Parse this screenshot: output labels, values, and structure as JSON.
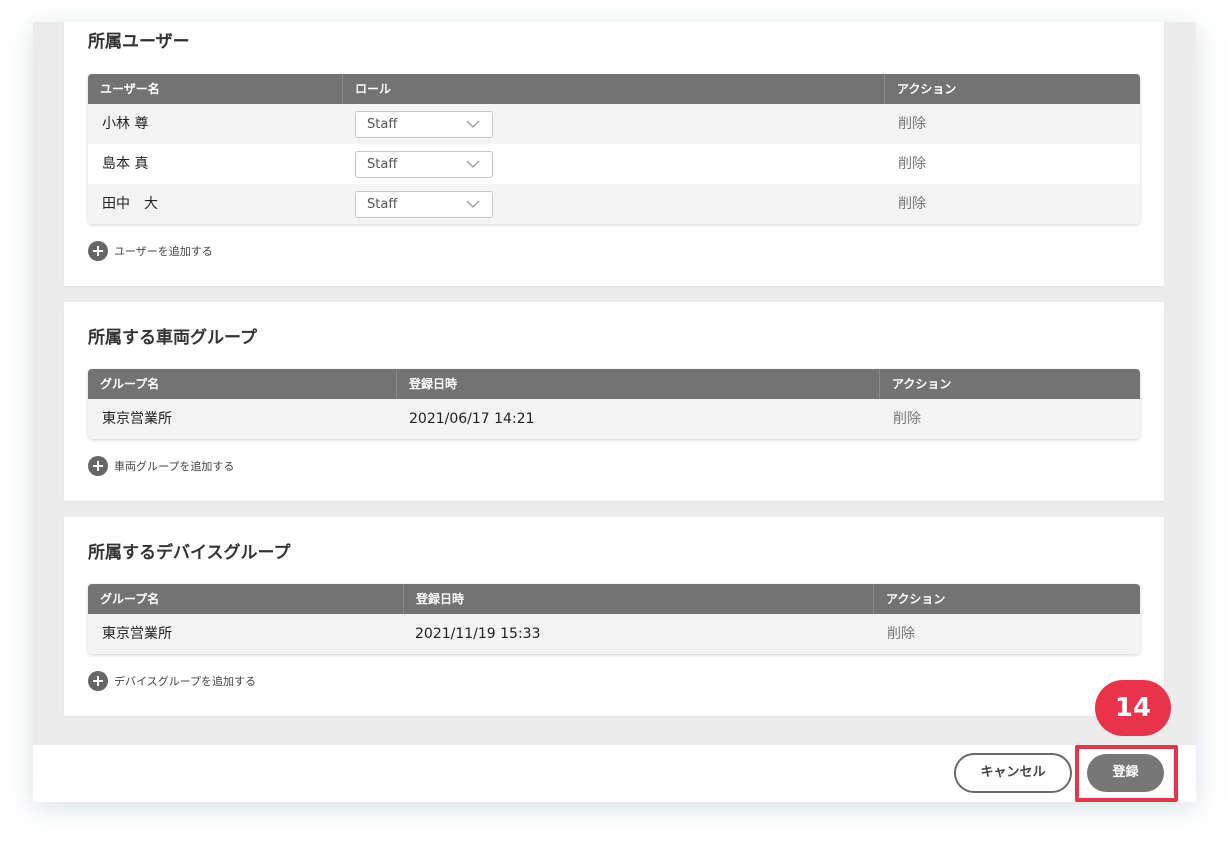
{
  "sections": {
    "users": {
      "title": "所属ユーザー",
      "headers": [
        "ユーザー名",
        "ロール",
        "アクション"
      ],
      "rows": [
        {
          "name": "小林 尊",
          "role": "Staff",
          "action": "削除"
        },
        {
          "name": "島本 真",
          "role": "Staff",
          "action": "削除"
        },
        {
          "name": "田中　大",
          "role": "Staff",
          "action": "削除"
        }
      ],
      "add_label": "ユーザーを追加する"
    },
    "vehicle_groups": {
      "title": "所属する車両グループ",
      "headers": [
        "グループ名",
        "登録日時",
        "アクション"
      ],
      "rows": [
        {
          "name": "東京営業所",
          "date": "2021/06/17 14:21",
          "action": "削除"
        }
      ],
      "add_label": "車両グループを追加する"
    },
    "device_groups": {
      "title": "所属するデバイスグループ",
      "headers": [
        "グループ名",
        "登録日時",
        "アクション"
      ],
      "rows": [
        {
          "name": "東京営業所",
          "date": "2021/11/19 15:33",
          "action": "削除"
        }
      ],
      "add_label": "デバイスグループを追加する"
    }
  },
  "footer": {
    "cancel_label": "キャンセル",
    "submit_label": "登録"
  },
  "annotation": {
    "step": "14",
    "color": "#e8334a"
  },
  "icons": {
    "dropdown": "chevron-down-icon",
    "add": "plus-circle-icon"
  }
}
